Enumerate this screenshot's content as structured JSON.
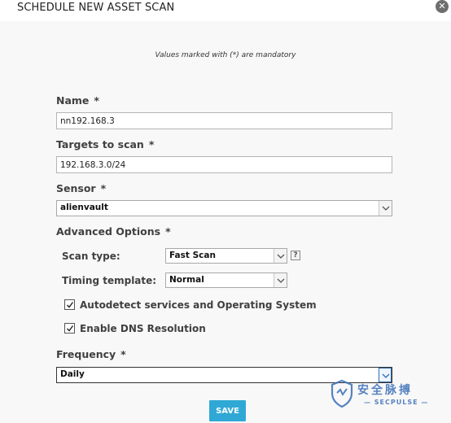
{
  "dialog": {
    "title": "SCHEDULE NEW ASSET SCAN",
    "close_icon": "close-icon"
  },
  "form": {
    "mandatory_note": "Values marked with (*) are mandatory",
    "required_marker": "*",
    "name": {
      "label": "Name",
      "value": "nn192.168.3"
    },
    "targets": {
      "label": "Targets to scan",
      "value": "192.168.3.0/24"
    },
    "sensor": {
      "label": "Sensor",
      "value": "alienvault"
    },
    "advanced": {
      "label": "Advanced Options",
      "scan_type": {
        "label": "Scan type:",
        "value": "Fast Scan",
        "help_icon": "help-icon",
        "help_text": "?"
      },
      "timing_template": {
        "label": "Timing template:",
        "value": "Normal"
      },
      "autodetect": {
        "label": "Autodetect services and Operating System",
        "checked": true
      },
      "dns": {
        "label": "Enable DNS Resolution",
        "checked": true
      }
    },
    "frequency": {
      "label": "Frequency",
      "value": "Daily"
    },
    "save_label": "SAVE"
  },
  "watermark": {
    "text": "安全脉搏",
    "sub": "— SECPULSE —",
    "color": "#3a6fb8"
  },
  "colors": {
    "accent": "#2fa8d5",
    "panel_bg": "#f8f8f8"
  }
}
